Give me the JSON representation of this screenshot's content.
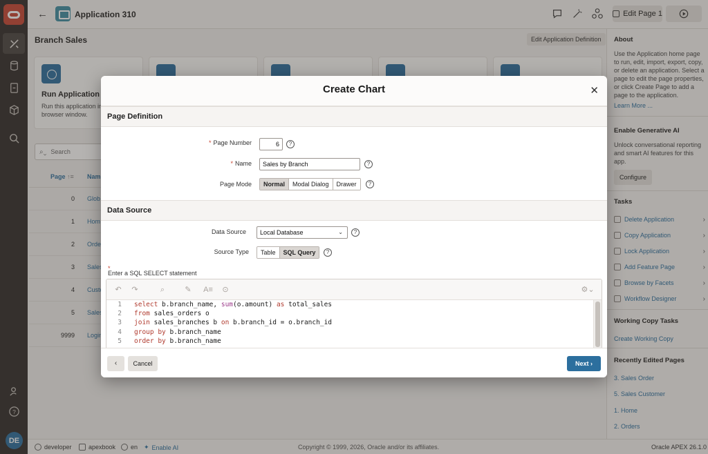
{
  "app": {
    "title": "Application 310",
    "edit_page_label": "Edit Page 1"
  },
  "rail": {
    "avatar_initials": "DE"
  },
  "page": {
    "region_title": "Branch Sales",
    "edit_definition_label": "Edit Application Definition",
    "cards": [
      {
        "title": "Run Application",
        "desc": "Run this application in a new browser window."
      }
    ],
    "search_placeholder": "Search",
    "grid_headers": {
      "page": "Page",
      "name": "Nam"
    },
    "rows": [
      {
        "page": "0",
        "name": "Glob"
      },
      {
        "page": "1",
        "name": "Hom"
      },
      {
        "page": "2",
        "name": "Orde"
      },
      {
        "page": "3",
        "name": "Sales"
      },
      {
        "page": "4",
        "name": "Custo"
      },
      {
        "page": "5",
        "name": "Sales"
      },
      {
        "page": "9999",
        "name": "Login"
      }
    ]
  },
  "sidebar": {
    "about_title": "About",
    "about_text": "Use the Application home page to run, edit, import, export, copy, or delete an application. Select a page to edit the page properties, or click Create Page to add a page to the application.",
    "learn_more": "Learn More ...",
    "genai_title": "Enable Generative AI",
    "genai_text": "Unlock conversational reporting and smart AI features for this app.",
    "configure_label": "Configure",
    "tasks_title": "Tasks",
    "tasks": [
      "Delete Application",
      "Copy Application",
      "Lock Application",
      "Add Feature Page",
      "Browse by Facets",
      "Workflow Designer"
    ],
    "working_copy_title": "Working Copy Tasks",
    "working_copy_link": "Create Working Copy",
    "recent_title": "Recently Edited Pages",
    "recent": [
      "3. Sales Order",
      "5. Sales Customer",
      "1. Home",
      "2. Orders"
    ]
  },
  "footer": {
    "user": "developer",
    "workspace": "apexbook",
    "language": "en",
    "enable_ai": "Enable AI",
    "copyright": "Copyright © 1999, 2026, Oracle and/or its affiliates.",
    "version": "Oracle APEX 26.1.0"
  },
  "modal": {
    "title": "Create Chart",
    "page_definition": {
      "heading": "Page Definition",
      "page_number_label": "Page Number",
      "page_number_value": "6",
      "name_label": "Name",
      "name_value": "Sales by Branch",
      "page_mode_label": "Page Mode",
      "page_mode_options": [
        "Normal",
        "Modal Dialog",
        "Drawer"
      ],
      "page_mode_selected": "Normal"
    },
    "data_source": {
      "heading": "Data Source",
      "data_source_label": "Data Source",
      "data_source_value": "Local Database",
      "source_type_label": "Source Type",
      "source_type_options": [
        "Table",
        "SQL Query"
      ],
      "source_type_selected": "SQL Query",
      "sql_label": "Enter a SQL SELECT statement",
      "sql_lines": [
        "select b.branch_name, sum(o.amount) as total_sales",
        "from sales_orders o",
        "join sales_branches b on b.branch_id = o.branch_id",
        "group by b.branch_name",
        "order by b.branch_name"
      ]
    },
    "cancel_label": "Cancel",
    "next_label": "Next"
  },
  "colors": {
    "accent": "#2c6f9e",
    "brand": "#c74634",
    "rail": "#312d2a"
  }
}
